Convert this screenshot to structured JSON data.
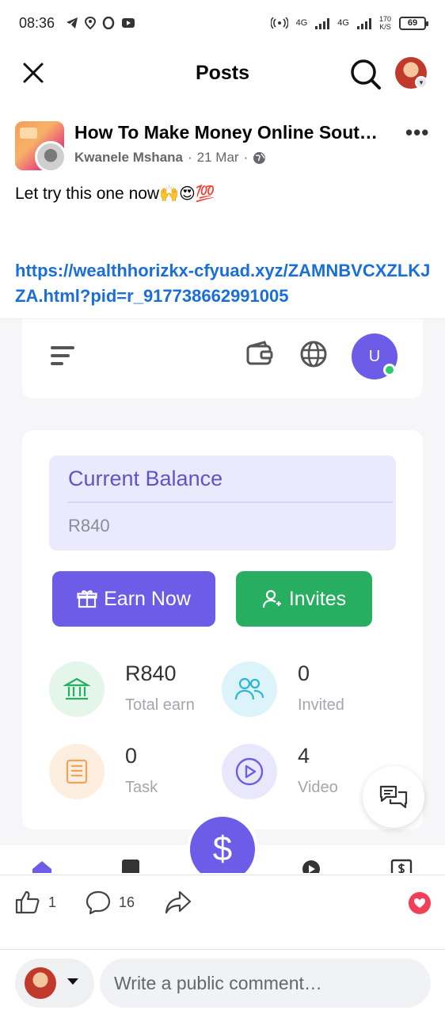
{
  "status_bar": {
    "time": "08:36",
    "net_label_1": "4G",
    "net_label_2": "4G",
    "speed_value": "170",
    "speed_unit": "K/S",
    "battery": "69"
  },
  "header": {
    "title": "Posts"
  },
  "post": {
    "group_name": "How To Make Money Online Sout…",
    "author": "Kwanele Mshana",
    "date": "21 Mar",
    "separator": "·",
    "text": "Let try this one now",
    "emoji": "🙌😍💯",
    "link": "https://wealthhorizkx-cfyuad.xyz/ZAMNBVCXZLKJZA.html?pid=r_917738662991005"
  },
  "shared_screenshot": {
    "user_initial": "U",
    "balance_label": "Current Balance",
    "balance_value": "R840",
    "earn_button": "Earn Now",
    "invites_button": "Invites",
    "stats": [
      {
        "value": "R840",
        "label": "Total earn"
      },
      {
        "value": "0",
        "label": "Invited"
      },
      {
        "value": "0",
        "label": "Task"
      },
      {
        "value": "4",
        "label": "Video"
      }
    ],
    "fab_symbol": "$",
    "colors": {
      "primary": "#6c5ce7",
      "green": "#27ae60",
      "balance_bg": "#ebe9fd"
    }
  },
  "reactions": {
    "like_count": "1",
    "comment_count": "16"
  },
  "composer": {
    "placeholder": "Write a public comment…"
  },
  "icons": [
    "close-icon",
    "search-icon",
    "more-icon",
    "globe-icon",
    "like-icon",
    "comment-icon",
    "share-icon",
    "love-icon",
    "wallet-icon",
    "chat-icon"
  ]
}
